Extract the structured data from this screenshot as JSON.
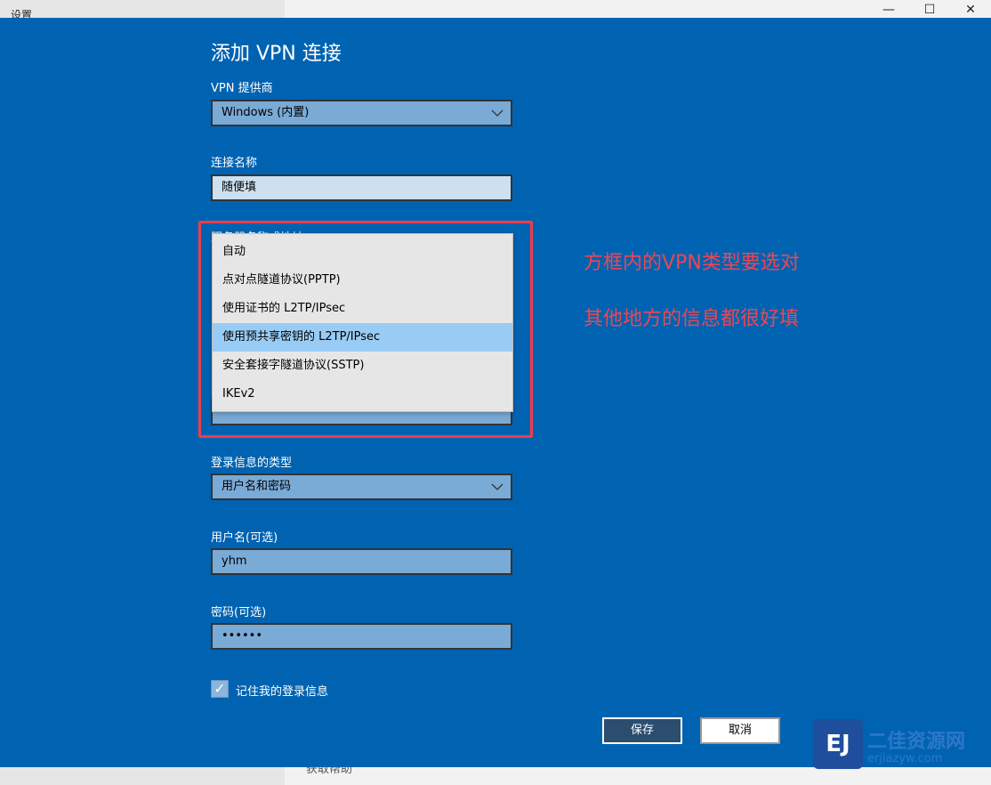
{
  "window": {
    "title": "设置",
    "minimize": "—",
    "maximize": "☐",
    "close": "✕",
    "help_link": "获取帮助"
  },
  "dialog": {
    "title": "添加 VPN 连接",
    "provider": {
      "label": "VPN 提供商",
      "value": "Windows (内置)"
    },
    "connection_name": {
      "label": "连接名称",
      "value": "随便填"
    },
    "server": {
      "label": "服务器名称或地址"
    },
    "vpn_type_options": [
      "自动",
      "点对点隧道协议(PPTP)",
      "使用证书的 L2TP/IPsec",
      "使用预共享密钥的 L2TP/IPsec",
      "安全套接字隧道协议(SSTP)",
      "IKEv2"
    ],
    "vpn_type_selected_index": 3,
    "hidden_password": "••••••",
    "signin_type": {
      "label": "登录信息的类型",
      "value": "用户名和密码"
    },
    "username": {
      "label": "用户名(可选)",
      "value": "yhm"
    },
    "password": {
      "label": "密码(可选)",
      "value": "••••••"
    },
    "remember": {
      "label": "记住我的登录信息",
      "checked": true
    },
    "save_label": "保存",
    "cancel_label": "取消"
  },
  "annotations": {
    "line1": "方框内的VPN类型要选对",
    "line2": "其他地方的信息都很好填"
  },
  "watermark": {
    "logo": "EJ",
    "text": "二佳资源网",
    "sub": "erjiazyw.com"
  },
  "colors": {
    "dialog_bg": "#0063b1",
    "highlight": "#f03c4a",
    "selected_option": "#99ccf5"
  },
  "icons": [
    "chevron-down-icon",
    "checkmark-icon",
    "minimize-icon",
    "maximize-icon",
    "close-icon"
  ]
}
